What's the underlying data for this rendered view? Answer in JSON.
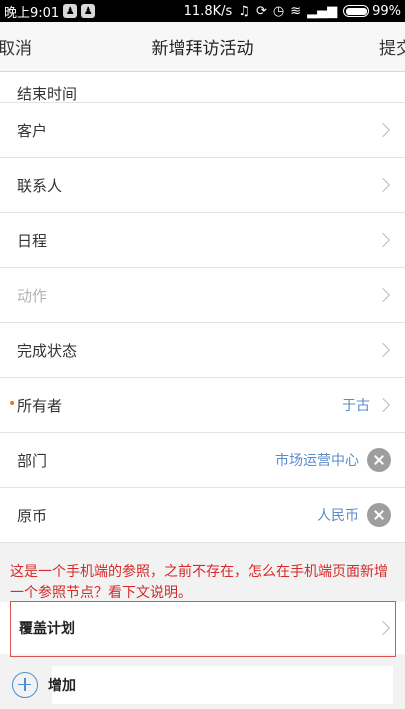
{
  "status_bar": {
    "time": "晚上9:01",
    "network_speed": "11.8K/s",
    "battery": "99%",
    "icons": [
      "app-notification-icon",
      "app-notification-icon",
      "headphones-icon",
      "sync-icon",
      "alarm-icon",
      "wifi-icon",
      "signal-icon",
      "battery-icon"
    ]
  },
  "nav": {
    "cancel_label": "取消",
    "title": "新增拜访活动",
    "submit_label": "提交"
  },
  "form": {
    "partial_row_label": "结束时间",
    "rows": [
      {
        "label": "客户"
      },
      {
        "label": "联系人"
      },
      {
        "label": "日程"
      },
      {
        "label": "动作"
      },
      {
        "label": "完成状态"
      },
      {
        "label": "所有者",
        "required_mark": "•",
        "value": "于古"
      },
      {
        "label": "部门",
        "value": "市场运营中心"
      },
      {
        "label": "原币",
        "value": "人民币"
      }
    ]
  },
  "annotation": {
    "text": "这是一个手机端的参照，之前不存在，怎么在手机端页面新增一个参照节点？看下文说明。",
    "color": "#d42a2a"
  },
  "coverage": {
    "label": "覆盖计划"
  },
  "add": {
    "label": "增加"
  },
  "colors": {
    "accent": "#4a8fd8",
    "value_text": "#5b8cc9",
    "required": "#e8781c"
  }
}
